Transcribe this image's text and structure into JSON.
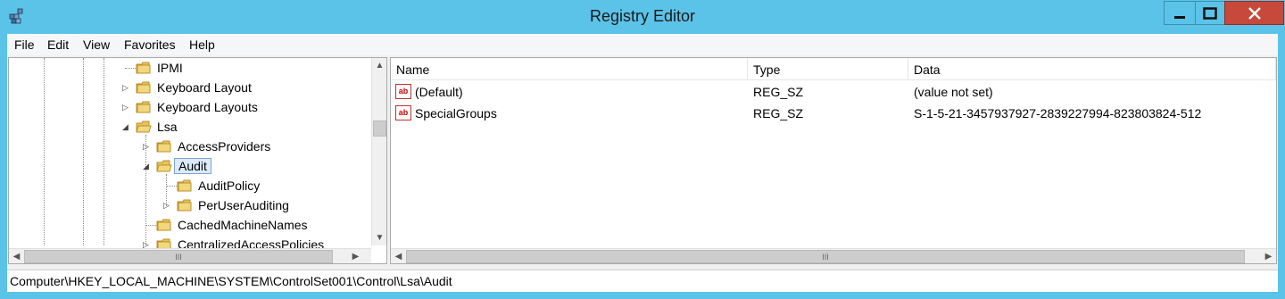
{
  "window": {
    "title": "Registry Editor"
  },
  "menu": [
    "File",
    "Edit",
    "View",
    "Favorites",
    "Help"
  ],
  "tree": {
    "items": [
      {
        "label": "IPMI",
        "expander": ""
      },
      {
        "label": "Keyboard Layout",
        "expander": "▷"
      },
      {
        "label": "Keyboard Layouts",
        "expander": "▷"
      },
      {
        "label": "Lsa",
        "expander": "◢"
      },
      {
        "label": "AccessProviders",
        "expander": "▷"
      },
      {
        "label": "Audit",
        "expander": "◢"
      },
      {
        "label": "AuditPolicy",
        "expander": ""
      },
      {
        "label": "PerUserAuditing",
        "expander": "▷"
      },
      {
        "label": "CachedMachineNames",
        "expander": ""
      },
      {
        "label": "CentralizedAccessPolicies",
        "expander": "▷"
      }
    ],
    "scroll_thumb_label": "III"
  },
  "list": {
    "columns": [
      "Name",
      "Type",
      "Data"
    ],
    "rows": [
      {
        "name": "(Default)",
        "type": "REG_SZ",
        "data": "(value not set)",
        "icon": "ab"
      },
      {
        "name": "SpecialGroups",
        "type": "REG_SZ",
        "data": "S-1-5-21-3457937927-2839227994-823803824-512",
        "icon": "ab"
      }
    ],
    "scroll_thumb_label": "III"
  },
  "status": {
    "path": "Computer\\HKEY_LOCAL_MACHINE\\SYSTEM\\ControlSet001\\Control\\Lsa\\Audit"
  },
  "colors": {
    "titlebar": "#5bc3e8",
    "close_button": "#c7493b",
    "selection": "#dcebfc"
  }
}
